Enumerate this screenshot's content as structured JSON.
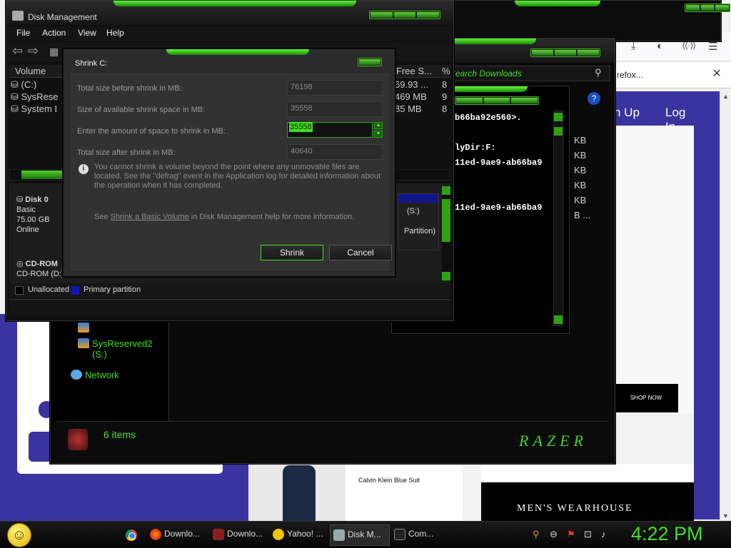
{
  "browser": {
    "tab_title": "refox...",
    "toolbar_icons": [
      "download-icon",
      "account-icon",
      "reader-icon",
      "menu-icon"
    ],
    "site": {
      "nav_signup": "n Up",
      "nav_login": "Log In",
      "shop_now": "SHOP NOW",
      "product_name": "Calvin Klein Blue Suit",
      "brand": "MEN'S WEARHOUSE"
    }
  },
  "explorer": {
    "search_placeholder": "Search Downloads",
    "nav_items": [
      {
        "label": "SysReserved2 (S:)"
      },
      {
        "label": "Network"
      }
    ],
    "item_count": "6 items",
    "logo_text": "RAZER"
  },
  "console": {
    "lines": [
      "b66ba92e560>.",
      "",
      "lyDir:F:",
      "11ed-9ae9-ab66ba9",
      "",
      "",
      "11ed-9ae9-ab66ba9"
    ],
    "kb_values": [
      "KB",
      "KB",
      "KB",
      "KB",
      "KB",
      "B ..."
    ]
  },
  "disk_management": {
    "title": "Disk Management",
    "menu": [
      "File",
      "Action",
      "View",
      "Help"
    ],
    "columns": {
      "volume": "Volume",
      "free": "Free S...",
      "pct": "%"
    },
    "volumes": [
      {
        "name": "(C:)",
        "free": "69.93 ...",
        "pct": "8"
      },
      {
        "name": "SysRese",
        "free": "469 MB",
        "pct": "9"
      },
      {
        "name": "System I",
        "free": "85 MB",
        "pct": "8"
      }
    ],
    "disk0": {
      "name": "Disk 0",
      "type": "Basic",
      "size": "75.00 GB",
      "status": "Online"
    },
    "cdrom": {
      "name": "CD-ROM",
      "desc": "CD-ROM (D:)"
    },
    "partition": {
      "letter": "(S:)",
      "type": "Partition)"
    },
    "legend": {
      "unallocated": "Unallocated",
      "primary": "Primary partition"
    }
  },
  "shrink_dialog": {
    "title": "Shrink C:",
    "fields": {
      "total_before_label": "Total size before shrink in MB:",
      "total_before_value": "76198",
      "available_label": "Size of available shrink space in MB:",
      "available_value": "35558",
      "amount_label": "Enter the amount of space to shrink in MB:",
      "amount_value": "35558",
      "total_after_label": "Total size after shrink in MB:",
      "total_after_value": "40640"
    },
    "info": "You cannot shrink a volume beyond the point where any unmovable files are located. See the \"defrag\" event in the Application log for detailed information about the operation when it has completed.",
    "help_prefix": "See ",
    "help_link": "Shrink a Basic Volume",
    "help_suffix": " in Disk Management help for more information.",
    "shrink_button": "Shrink",
    "cancel_button": "Cancel"
  },
  "taskbar": {
    "items": [
      {
        "label": "Downlo...",
        "icon": "firefox-icon"
      },
      {
        "label": "Downlo...",
        "icon": "explorer-icon"
      },
      {
        "label": "Yahoo! ...",
        "icon": "yahoo-icon"
      },
      {
        "label": "Disk M...",
        "icon": "disk-management-icon"
      },
      {
        "label": "Com...",
        "icon": "command-prompt-icon"
      }
    ],
    "clock": "4:22 PM"
  },
  "colors": {
    "accent": "#3ee01f",
    "razer_purple": "#3a34a0"
  }
}
